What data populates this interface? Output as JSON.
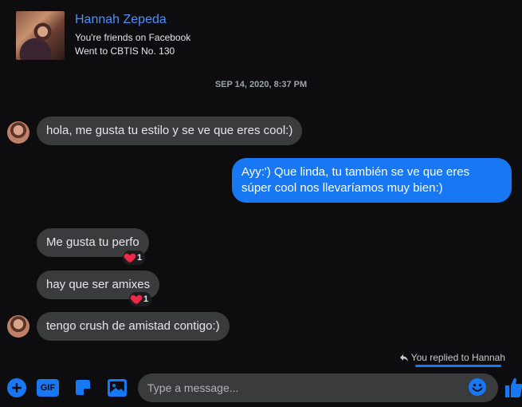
{
  "header": {
    "name": "Hannah Zepeda",
    "friends_line": "You're friends on Facebook",
    "school_line": "Went to CBTIS No. 130"
  },
  "timestamp": "SEP 14, 2020, 8:37 PM",
  "messages": [
    {
      "text": "hola, me gusta tu estilo y se ve que eres cool:)",
      "direction": "incoming"
    },
    {
      "text": "Ayy:') Que linda, tu también se ve que eres súper cool nos llevaríamos muy bien:)",
      "direction": "outgoing"
    },
    {
      "text": "Me gusta tu perfo",
      "direction": "incoming",
      "reaction": {
        "icon": "heart-icon",
        "count": "1"
      }
    },
    {
      "text": "hay que ser amixes",
      "direction": "incoming",
      "reaction": {
        "icon": "heart-icon",
        "count": "1"
      }
    },
    {
      "text": "tengo crush de amistad contigo:)",
      "direction": "incoming"
    }
  ],
  "replied_notice": "You replied to Hannah",
  "composer": {
    "placeholder": "Type a message...",
    "gif_label": "GIF",
    "icons": [
      "plus-icon",
      "gif-icon",
      "sticker-icon",
      "image-icon",
      "emoji-icon",
      "thumbs-up-icon"
    ]
  },
  "colors": {
    "background": "#0d0d10",
    "incoming_bubble": "#3a3b3c",
    "outgoing_bubble": "#1877f2",
    "accent": "#1877f2",
    "name_link": "#4f8ff7"
  }
}
